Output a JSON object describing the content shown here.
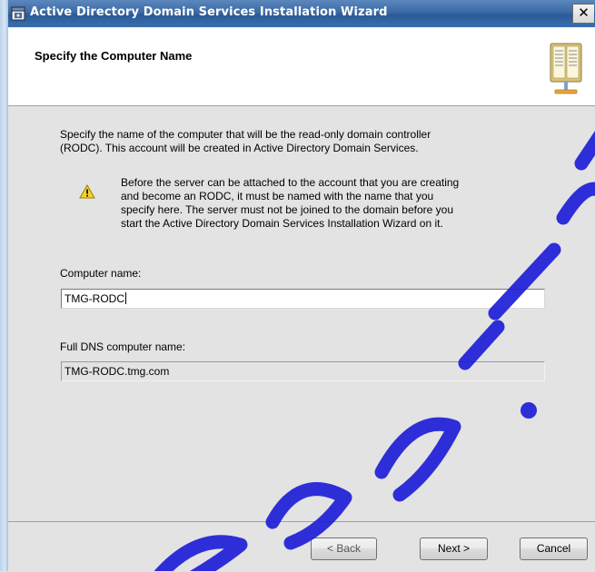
{
  "window": {
    "title": "Active Directory Domain Services Installation Wizard",
    "close_label": "✕",
    "app_icon": "wizard-app-icon",
    "titlebar_color": "#3b6aa6"
  },
  "header": {
    "title": "Specify the Computer Name",
    "icon": "book-icon"
  },
  "intro": {
    "line1": "Specify the name of the computer that will be the read-only domain controller",
    "line2": "(RODC). This account will be created in Active Directory Domain Services."
  },
  "warning": {
    "icon": "warning-icon",
    "line1": "Before the server can be attached to the account that you are creating",
    "line2": "and become an RODC, it must be named with the name that you",
    "line3": "specify here. The server must not be joined to the domain before you",
    "line4": "start the Active Directory Domain Services Installation Wizard on it."
  },
  "computer_name": {
    "label": "Computer name:",
    "value": "TMG-RODC"
  },
  "dns_name": {
    "label": "Full DNS computer name:",
    "value": "TMG-RODC.tmg.com"
  },
  "buttons": {
    "back": "< Back",
    "next": "Next >",
    "cancel": "Cancel"
  },
  "watermark_color": "#1a1ad6"
}
